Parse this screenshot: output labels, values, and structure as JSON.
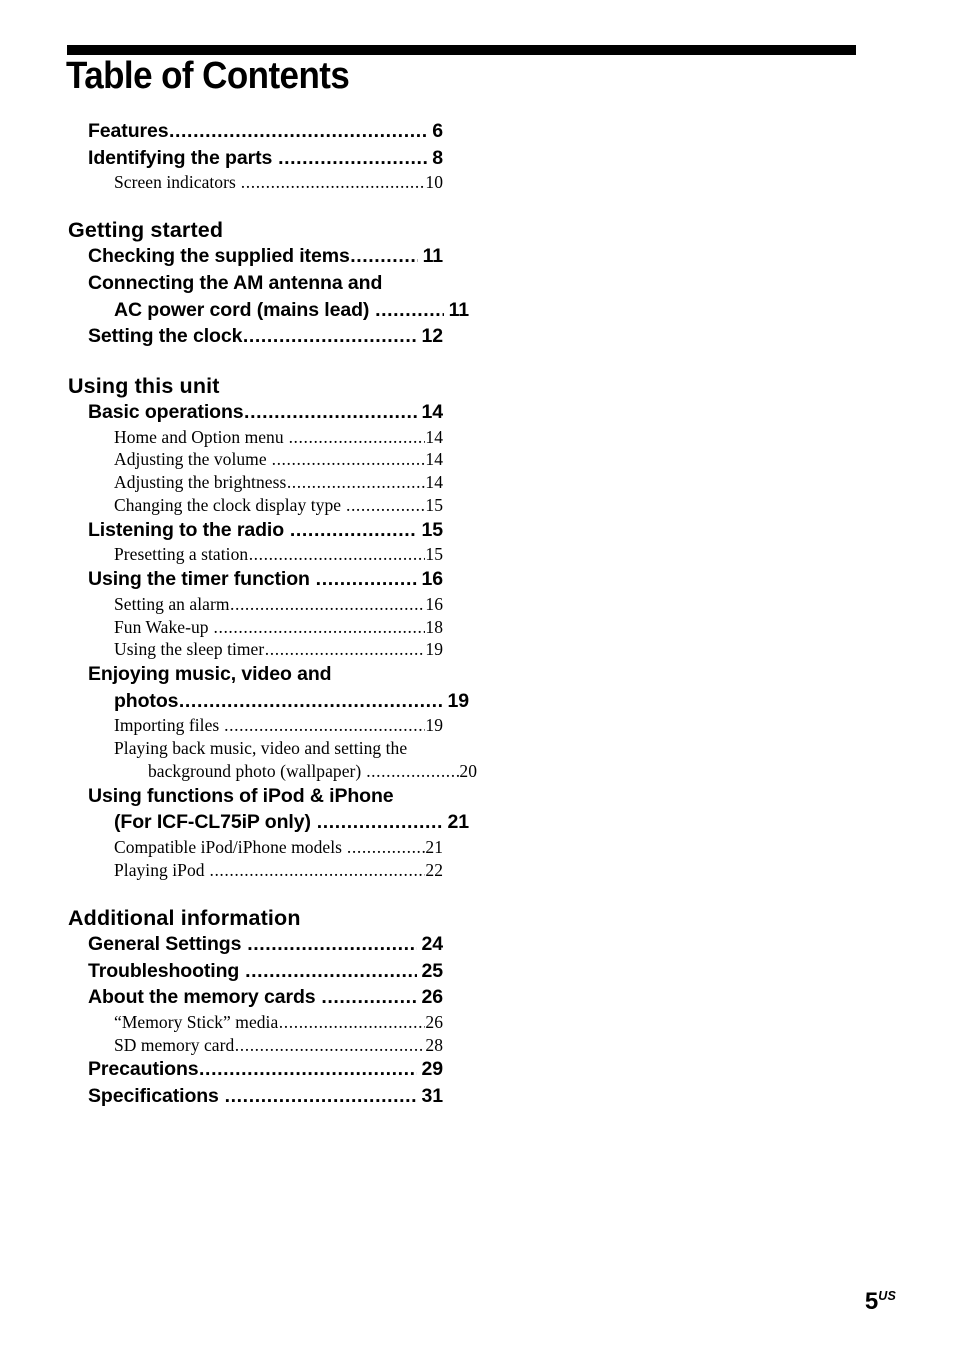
{
  "document": {
    "title": "Table of Contents",
    "footer_page": "5",
    "footer_region": "US"
  },
  "toc": {
    "intro_entries": [
      {
        "label": "Features",
        "page": "6",
        "level": 1
      },
      {
        "label": "Identifying the parts ",
        "page": "8",
        "level": 1
      },
      {
        "label": "Screen indicators ",
        "page": "10",
        "level": 2
      }
    ],
    "sections": [
      {
        "heading": "Getting started",
        "entries": [
          {
            "label": "Checking the supplied items",
            "page": "11",
            "level": 1
          },
          {
            "label": "Connecting the AM antenna and",
            "cont": "AC power cord (mains lead) ",
            "page": "11",
            "level": 1
          },
          {
            "label": "Setting the clock",
            "page": "12",
            "level": 1
          }
        ]
      },
      {
        "heading": "Using this unit",
        "entries": [
          {
            "label": "Basic operations",
            "page": "14",
            "level": 1
          },
          {
            "label": "Home and Option menu ",
            "page": "14",
            "level": 2
          },
          {
            "label": "Adjusting the volume ",
            "page": "14",
            "level": 2
          },
          {
            "label": "Adjusting the brightness",
            "page": "14",
            "level": 2
          },
          {
            "label": "Changing the clock display type ",
            "page": "15",
            "level": 2
          },
          {
            "label": "Listening to the radio ",
            "page": "15",
            "level": 1
          },
          {
            "label": "Presetting a station",
            "page": "15",
            "level": 2
          },
          {
            "label": "Using the timer function ",
            "page": "16",
            "level": 1
          },
          {
            "label": "Setting an alarm",
            "page": "16",
            "level": 2
          },
          {
            "label": "Fun Wake-up ",
            "page": "18",
            "level": 2
          },
          {
            "label": "Using the sleep timer",
            "page": "19",
            "level": 2
          },
          {
            "label": "Enjoying music, video and",
            "cont": "photos",
            "page": "19",
            "level": 1
          },
          {
            "label": "Importing files ",
            "page": "19",
            "level": 2
          },
          {
            "label": "Playing back music, video and setting the",
            "cont": "background photo (wallpaper) ",
            "page": "20",
            "level": 2
          },
          {
            "label": "Using functions of iPod & iPhone",
            "cont": "(For ICF-CL75iP only) ",
            "page": "21",
            "level": 1
          },
          {
            "label": "Compatible iPod/iPhone models ",
            "page": "21",
            "level": 2
          },
          {
            "label": "Playing iPod ",
            "page": "22",
            "level": 2
          }
        ]
      },
      {
        "heading": "Additional information",
        "entries": [
          {
            "label": "General Settings ",
            "page": "24",
            "level": 1
          },
          {
            "label": "Troubleshooting ",
            "page": "25",
            "level": 1
          },
          {
            "label": "About the memory cards ",
            "page": "26",
            "level": 1
          },
          {
            "label": "“Memory Stick” media",
            "page": "26",
            "level": 2
          },
          {
            "label": "SD memory card",
            "page": "28",
            "level": 2
          },
          {
            "label": "Precautions",
            "page": "29",
            "level": 1
          },
          {
            "label": "Specifications ",
            "page": "31",
            "level": 1
          }
        ]
      }
    ]
  }
}
